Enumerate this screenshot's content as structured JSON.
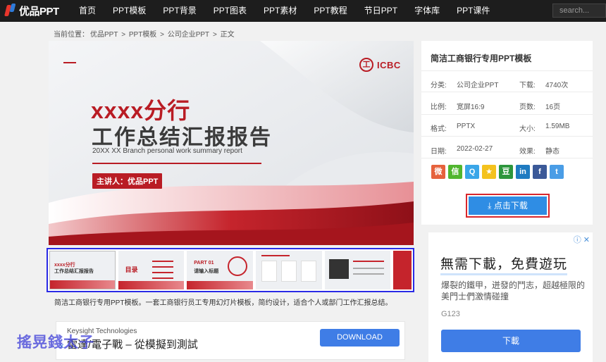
{
  "brand": {
    "name": "优品PPT"
  },
  "nav": [
    "首页",
    "PPT模板",
    "PPT背景",
    "PPT图表",
    "PPT素材",
    "PPT教程",
    "节日PPT",
    "字体库",
    "PPT课件"
  ],
  "search": {
    "placeholder": "search..."
  },
  "breadcrumb": [
    "当前位置：",
    "优品PPT",
    ">",
    "PPT模板",
    ">",
    "公司企业PPT",
    ">",
    "正文"
  ],
  "slide": {
    "logo_text": "ICBC",
    "logo_glyph": "工",
    "title_red": "xxxx分行",
    "title_main": "工作总结汇报报告",
    "subtitle_en": "20XX XX Branch personal work summary report",
    "presenter": "主讲人：优品PPT"
  },
  "thumbnails": {
    "t1_line1": "xxxx分行",
    "t1_line2": "工作总结汇报报告",
    "t2_text": "目录",
    "t3_part": "PART 01",
    "t3_title": "请输入标题"
  },
  "description": "简洁工商银行专用PPT模板。一套工商银行员工专用幻灯片模板，简约设计，适合个人或部门工作汇报总结。",
  "info": {
    "title": "简洁工商银行专用PPT模板",
    "rows": [
      {
        "k": "分类:",
        "v": "公司企业PPT",
        "k2": "下载:",
        "v2": "4740次"
      },
      {
        "k": "比例:",
        "v": "宽屏16:9",
        "k2": "页数:",
        "v2": "16页"
      },
      {
        "k": "格式:",
        "v": "PPTX",
        "k2": "大小:",
        "v2": "1.59MB"
      },
      {
        "k": "日期:",
        "v": "2022-02-27",
        "k2": "效果:",
        "v2": "静态"
      }
    ],
    "download_label": "点击下载"
  },
  "shares": [
    {
      "icon": "weibo-icon",
      "glyph": "微",
      "color": "#e6623c"
    },
    {
      "icon": "wechat-icon",
      "glyph": "信",
      "color": "#51b62f"
    },
    {
      "icon": "qq-icon",
      "glyph": "Q",
      "color": "#3aa6e8"
    },
    {
      "icon": "qzone-icon",
      "glyph": "★",
      "color": "#f4c21d"
    },
    {
      "icon": "douban-icon",
      "glyph": "豆",
      "color": "#2e963d"
    },
    {
      "icon": "linkedin-icon",
      "glyph": "in",
      "color": "#1f7bc1"
    },
    {
      "icon": "facebook-icon",
      "glyph": "f",
      "color": "#3b5998"
    },
    {
      "icon": "twitter-icon",
      "glyph": "t",
      "color": "#4a9de6"
    }
  ],
  "ad_left": {
    "source": "Keysight Technologies",
    "headline": "雷達/電子戰 – 從模擬到測試",
    "button": "DOWNLOAD"
  },
  "ad_right": {
    "headline": "無需下載，免費遊玩",
    "body": "爆裂的鐵甲，迸發的鬥志，超越極限的美門士們激情碰撞",
    "advertiser": "G123",
    "button": "下載"
  },
  "watermark": "搖晃錢太子"
}
